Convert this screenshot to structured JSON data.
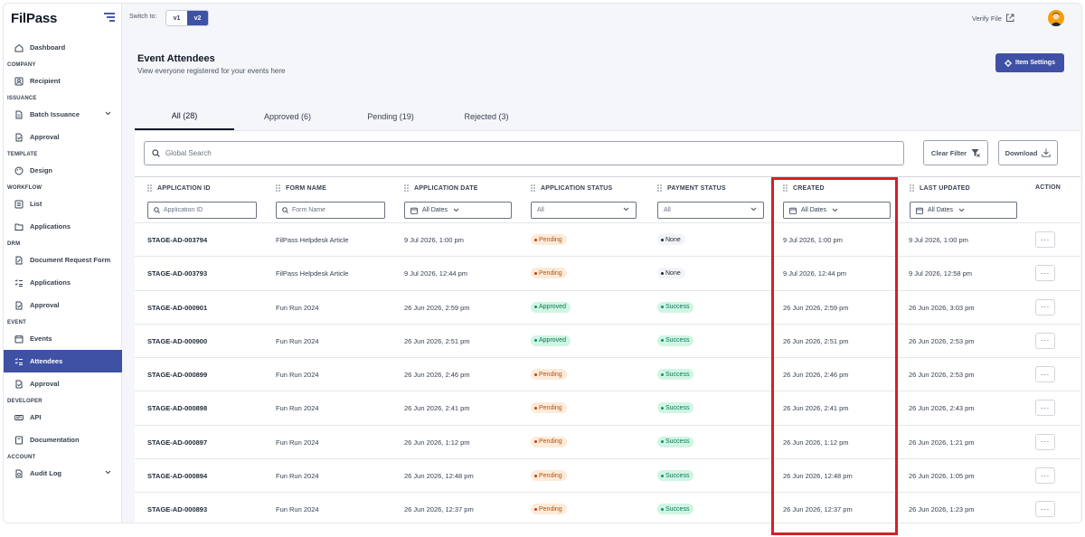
{
  "app": {
    "logo": "FilPass"
  },
  "sidebar": {
    "groups": [
      {
        "section": "",
        "items": [
          {
            "label": "Dashboard",
            "icon": "home-icon"
          }
        ]
      },
      {
        "section": "COMPANY",
        "items": [
          {
            "label": "Recipient",
            "icon": "contact-icon"
          }
        ]
      },
      {
        "section": "ISSUANCE",
        "items": [
          {
            "label": "Batch Issuance",
            "icon": "document-stack-icon",
            "expandable": true
          },
          {
            "label": "Approval",
            "icon": "document-check-icon"
          }
        ]
      },
      {
        "section": "TEMPLATE",
        "items": [
          {
            "label": "Design",
            "icon": "palette-icon"
          }
        ]
      },
      {
        "section": "WORKFLOW",
        "items": [
          {
            "label": "List",
            "icon": "list-icon"
          },
          {
            "label": "Applications",
            "icon": "folder-icon"
          }
        ]
      },
      {
        "section": "DRM",
        "items": [
          {
            "label": "Document Request Form",
            "icon": "document-edit-icon"
          },
          {
            "label": "Applications",
            "icon": "list-check-icon"
          },
          {
            "label": "Approval",
            "icon": "document-check-icon"
          }
        ]
      },
      {
        "section": "EVENT",
        "items": [
          {
            "label": "Events",
            "icon": "calendar-icon"
          },
          {
            "label": "Attendees",
            "icon": "list-check-icon",
            "active": true
          },
          {
            "label": "Approval",
            "icon": "document-check-icon"
          }
        ]
      },
      {
        "section": "DEVELOPER",
        "items": [
          {
            "label": "API",
            "icon": "api-icon"
          },
          {
            "label": "Documentation",
            "icon": "book-icon"
          }
        ]
      },
      {
        "section": "ACCOUNT",
        "items": [
          {
            "label": "Audit Log",
            "icon": "audit-icon",
            "expandable": true
          }
        ]
      }
    ]
  },
  "topbar": {
    "switch_label": "Switch to:",
    "v1": "v1",
    "v2": "v2",
    "verify_label": "Verify File"
  },
  "header": {
    "title": "Event Attendees",
    "subtitle": "View everyone registered for your events here",
    "settings_label": "Item Settings"
  },
  "tabs": [
    {
      "label": "All (28)",
      "active": true
    },
    {
      "label": "Approved (6)"
    },
    {
      "label": "Pending (19)"
    },
    {
      "label": "Rejected (3)"
    }
  ],
  "toolbar": {
    "search_placeholder": "Global Search",
    "clear_filter": "Clear Filter",
    "download": "Download"
  },
  "columns": {
    "application_id": "APPLICATION ID",
    "form_name": "FORM NAME",
    "application_date": "APPLICATION DATE",
    "application_status": "APPLICATION STATUS",
    "payment_status": "PAYMENT STATUS",
    "created": "CREATED",
    "last_updated": "LAST UPDATED",
    "action": "ACTION"
  },
  "filters": {
    "application_id_placeholder": "Application ID",
    "form_name_placeholder": "Form Name",
    "application_date": "All Dates",
    "application_status": "All",
    "payment_status": "All",
    "created": "All Dates",
    "last_updated": "All Dates"
  },
  "rows": [
    {
      "id": "STAGE-AD-003794",
      "form": "FilPass Helpdesk Article",
      "app_date": "9 Jul 2026, 1:00 pm",
      "app_status": "Pending",
      "pay_status": "None",
      "created": "9 Jul 2026, 1:00 pm",
      "updated": "9 Jul 2026, 1:00 pm",
      "action": "···"
    },
    {
      "id": "STAGE-AD-003793",
      "form": "FilPass Helpdesk Article",
      "app_date": "9 Jul 2026, 12:44 pm",
      "app_status": "Pending",
      "pay_status": "None",
      "created": "9 Jul 2026, 12:44 pm",
      "updated": "9 Jul 2026, 12:58 pm",
      "action": "···"
    },
    {
      "id": "STAGE-AD-000901",
      "form": "Fun Run 2024",
      "app_date": "26 Jun 2026, 2:59 pm",
      "app_status": "Approved",
      "pay_status": "Success",
      "created": "26 Jun 2026, 2:59 pm",
      "updated": "26 Jun 2026, 3:03 pm",
      "action": "···"
    },
    {
      "id": "STAGE-AD-000900",
      "form": "Fun Run 2024",
      "app_date": "26 Jun 2026, 2:51 pm",
      "app_status": "Approved",
      "pay_status": "Success",
      "created": "26 Jun 2026, 2:51 pm",
      "updated": "26 Jun 2026, 2:53 pm",
      "action": "···"
    },
    {
      "id": "STAGE-AD-000899",
      "form": "Fun Run 2024",
      "app_date": "26 Jun 2026, 2:46 pm",
      "app_status": "Pending",
      "pay_status": "Success",
      "created": "26 Jun 2026, 2:46 pm",
      "updated": "26 Jun 2026, 2:53 pm",
      "action": "···"
    },
    {
      "id": "STAGE-AD-000898",
      "form": "Fun Run 2024",
      "app_date": "26 Jun 2026, 2:41 pm",
      "app_status": "Pending",
      "pay_status": "Success",
      "created": "26 Jun 2026, 2:41 pm",
      "updated": "26 Jun 2026, 2:43 pm",
      "action": "···"
    },
    {
      "id": "STAGE-AD-000897",
      "form": "Fun Run 2024",
      "app_date": "26 Jun 2026, 1:12 pm",
      "app_status": "Pending",
      "pay_status": "Success",
      "created": "26 Jun 2026, 1:12 pm",
      "updated": "26 Jun 2026, 1:21 pm",
      "action": "···"
    },
    {
      "id": "STAGE-AD-000894",
      "form": "Fun Run 2024",
      "app_date": "26 Jun 2026, 12:48 pm",
      "app_status": "Pending",
      "pay_status": "Success",
      "created": "26 Jun 2026, 12:48 pm",
      "updated": "26 Jun 2026, 1:05 pm",
      "action": "···"
    },
    {
      "id": "STAGE-AD-000893",
      "form": "Fun Run 2024",
      "app_date": "26 Jun 2026, 12:37 pm",
      "app_status": "Pending",
      "pay_status": "Success",
      "created": "26 Jun 2026, 12:37 pm",
      "updated": "26 Jun 2026, 1:23 pm",
      "action": "···"
    }
  ],
  "colors": {
    "primary": "#3f51a5",
    "highlight": "#d61f26",
    "pending_bg": "#fdebd9",
    "success_bg": "#d1f5e3"
  }
}
